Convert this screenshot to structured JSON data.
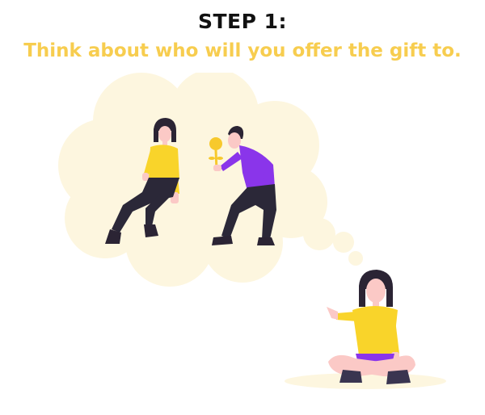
{
  "heading": {
    "step_label": "STEP 1:",
    "instruction": "Think about who will you offer the gift to."
  },
  "colors": {
    "title": "#111111",
    "accent": "#f7cd4f",
    "cloud": "#fdf6df",
    "shirt_yellow": "#f9d42a",
    "shirt_purple": "#8a35ea",
    "pants_dark": "#2b2838",
    "skin": "#fbc9c6",
    "hair": "#2b2434",
    "flower": "#f7c92d"
  },
  "illustration": {
    "icons": [
      "thought-cloud-icon",
      "woman-sitting-icon",
      "man-with-flower-icon",
      "girl-crosslegged-icon"
    ]
  }
}
